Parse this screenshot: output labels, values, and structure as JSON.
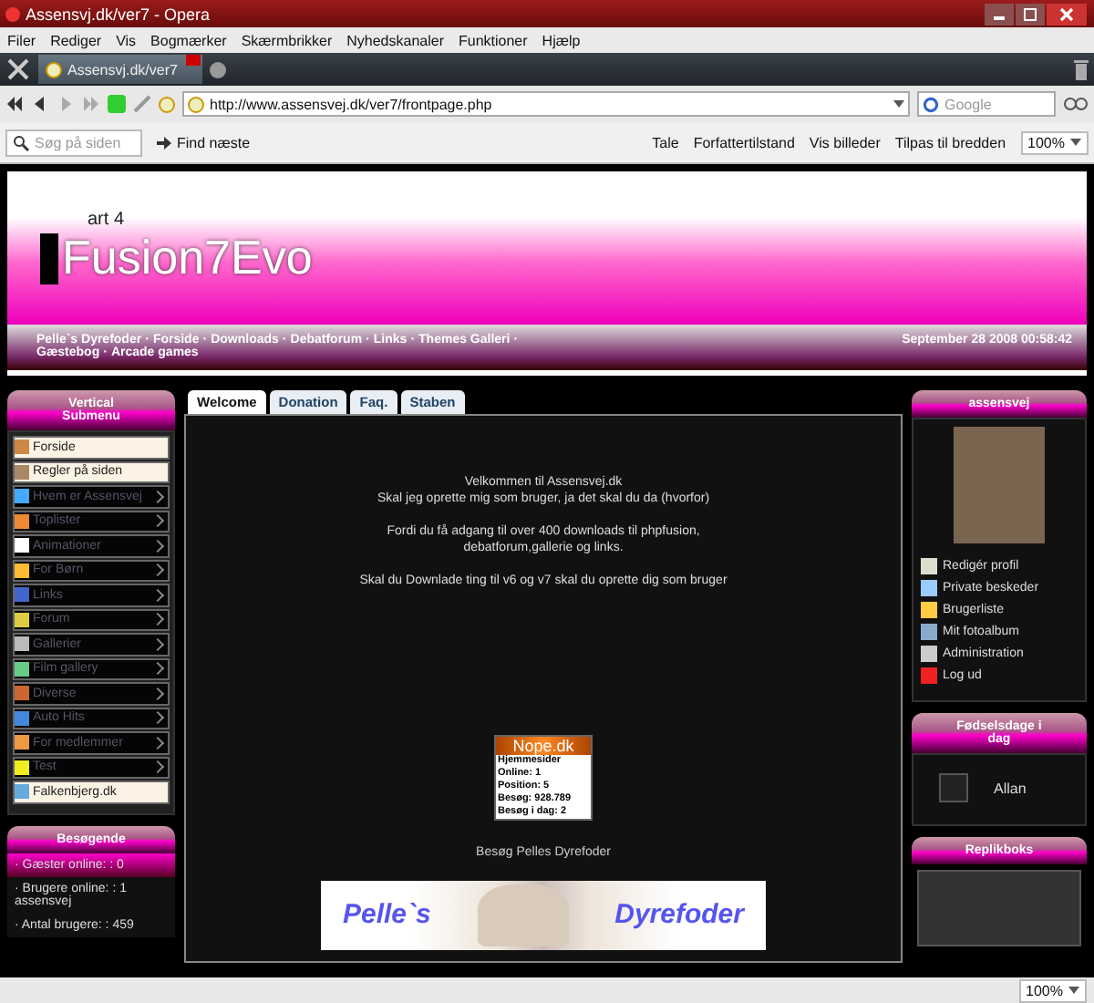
{
  "window": {
    "title": "Assensvj.dk/ver7 - Opera"
  },
  "menu": [
    "Filer",
    "Rediger",
    "Vis",
    "Bogmærker",
    "Skærmbrikker",
    "Nyhedskanaler",
    "Funktioner",
    "Hjælp"
  ],
  "tabs": [
    {
      "label": "Assensvj.dk/ver7",
      "selected": true
    }
  ],
  "address": {
    "url": "http://www.assensvej.dk/ver7/frontpage.php"
  },
  "search": {
    "placeholder": "Google"
  },
  "toolbar": {
    "find_placeholder": "Søg på siden",
    "find_next": "Find næste",
    "items": [
      "Tale",
      "Forfattertilstand",
      "Vis billeder",
      "Tilpas til bredden"
    ],
    "zoom": "100%"
  },
  "site": {
    "logo_small": "art 4",
    "logo": "Fusion7Evo",
    "separator": "·",
    "nav": [
      "Pelle`s Dyrefoder",
      "Forside",
      "Downloads",
      "Debatforum",
      "Links",
      "Themes Galleri",
      "Gæstebog",
      "Arcade games"
    ],
    "date": "September 28 2008 00:58:42"
  },
  "left": {
    "title": "Vertical Submenu",
    "items": [
      {
        "label": "Forside",
        "kind": "light"
      },
      {
        "label": "Regler på siden",
        "kind": "light"
      },
      {
        "label": "Hvem er Assensvej",
        "kind": "dark"
      },
      {
        "label": "Toplister",
        "kind": "dark"
      },
      {
        "label": "Animationer",
        "kind": "dark"
      },
      {
        "label": "For Børn",
        "kind": "dark"
      },
      {
        "label": "Links",
        "kind": "dark"
      },
      {
        "label": "Forum",
        "kind": "dark"
      },
      {
        "label": "Gallerier",
        "kind": "dark"
      },
      {
        "label": "Film gallery",
        "kind": "dark"
      },
      {
        "label": "Diverse",
        "kind": "dark"
      },
      {
        "label": "Auto Hits",
        "kind": "dark"
      },
      {
        "label": "For medlemmer",
        "kind": "dark"
      },
      {
        "label": "Test",
        "kind": "dark"
      },
      {
        "label": "Falkenbjerg.dk",
        "kind": "light"
      }
    ],
    "visitors_title": "Besøgende",
    "visitors": [
      {
        "text": "· Gæster online: : 0",
        "highlighted": true
      },
      {
        "text": "· Brugere online: : 1 assensvej",
        "highlighted": false
      },
      {
        "text": "· Antal brugere: : 459",
        "highlighted": false
      }
    ]
  },
  "center": {
    "tabs": [
      {
        "label": "Welcome",
        "selected": true
      },
      {
        "label": "Donation",
        "selected": false
      },
      {
        "label": "Faq.",
        "selected": false
      },
      {
        "label": "Staben",
        "selected": false
      }
    ],
    "paragraphs": [
      [
        "Velkommen til Assensvej.dk",
        "Skal jeg oprette mig som bruger, ja det skal du da (hvorfor)"
      ],
      [
        "Fordi du få adgang til over 400 downloads til phpfusion,",
        "debatforum,gallerie og links."
      ],
      [
        "Skal du Downlade ting til v6 og v7 skal du oprette dig som bruger"
      ]
    ],
    "counter": {
      "title": "Nope.dk",
      "lines": [
        "Hjemmesider",
        "Online:   1",
        "Position:   5",
        "Besøg:   928.789",
        "Besøg i dag:   2"
      ]
    },
    "visit_link": "Besøg Pelles Dyrefoder",
    "banner": [
      "Pelle`s",
      "Dyrefoder"
    ]
  },
  "right": {
    "user_title": "assensvej",
    "links": [
      "Redigér profil",
      "Private beskeder",
      "Brugerliste",
      "Mit fotoalbum",
      "Administration",
      "Log ud"
    ],
    "birthday_title": "Fødselsdage i dag",
    "birthdays": [
      "Allan"
    ],
    "shout_title": "Replikboks"
  },
  "status_bar": {
    "zoom": "100%"
  }
}
